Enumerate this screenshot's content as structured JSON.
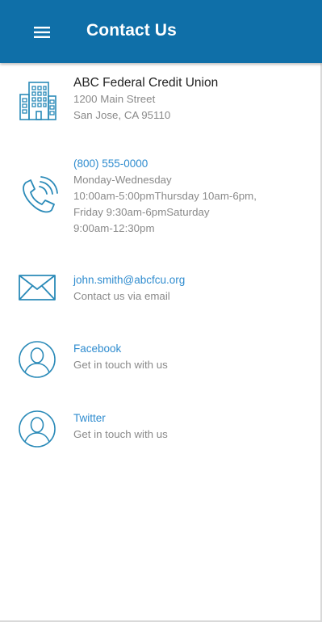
{
  "header": {
    "title": "Contact Us",
    "menu_icon": "hamburger-menu-icon",
    "background": "#0f6fa8"
  },
  "contacts": {
    "branch": {
      "icon": "building-icon",
      "name": "ABC Federal Credit Union",
      "address_line1": "1200 Main Street",
      "address_line2": "San Jose, CA 95110"
    },
    "phone": {
      "icon": "phone-icon",
      "number": "(800) 555-0000",
      "hours_line1": "Monday-Wednesday",
      "hours_line2": "10:00am-5:00pmThursday 10am-6pm,",
      "hours_line3": "Friday 9:30am-6pmSaturday",
      "hours_line4": "9:00am-12:30pm"
    },
    "email": {
      "icon": "envelope-icon",
      "address": "john.smith@abcfcu.org",
      "caption": "Contact us via email"
    },
    "facebook": {
      "icon": "person-circle-icon",
      "label": "Facebook",
      "caption": "Get in touch with us"
    },
    "twitter": {
      "icon": "person-circle-icon",
      "label": "Twitter",
      "caption": "Get in touch with us"
    }
  },
  "colors": {
    "accent": "#2f8ccf",
    "icon_stroke": "#2a8ab8",
    "secondary_text": "#8a8a8a"
  }
}
